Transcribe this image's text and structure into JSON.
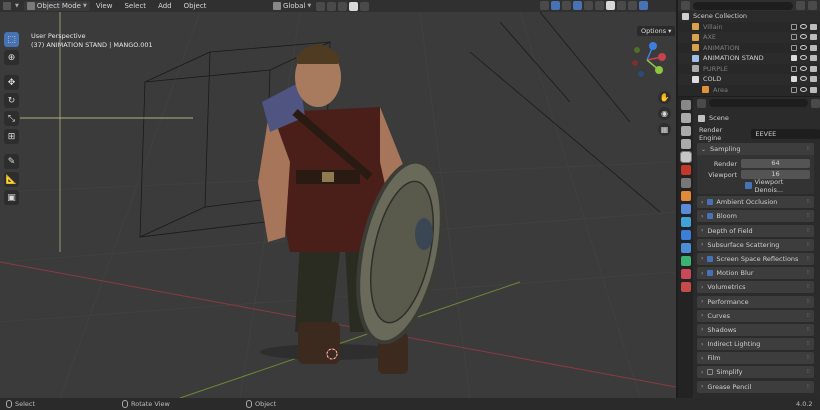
{
  "header": {
    "mode": "Object Mode",
    "menus": [
      "View",
      "Select",
      "Add",
      "Object"
    ],
    "transform_orientation": "Global",
    "options_label": "Options"
  },
  "viewport": {
    "perspective": "User Perspective",
    "object_info": "(37) ANIMATION STAND | MANGO.001"
  },
  "outliner": {
    "root": "Scene Collection",
    "items": [
      {
        "label": "Villain",
        "dim": true,
        "color": "#d9a24a"
      },
      {
        "label": "AXE",
        "dim": true,
        "color": "#d9a24a"
      },
      {
        "label": "ANIMATION",
        "dim": true,
        "color": "#d9a24a"
      },
      {
        "label": "ANIMATION STAND",
        "dim": false,
        "color": "#9ec0e8"
      },
      {
        "label": "PURPLE",
        "dim": true,
        "color": "#aaaaaa"
      },
      {
        "label": "COLD",
        "dim": false,
        "color": "#dddddd"
      },
      {
        "label": "Area",
        "dim": true,
        "color": "#e0913a"
      }
    ]
  },
  "properties": {
    "context": "Scene",
    "render_engine_label": "Render Engine",
    "render_engine": "EEVEE",
    "sampling": {
      "title": "Sampling",
      "render_label": "Render",
      "render_value": "64",
      "viewport_label": "Viewport",
      "viewport_value": "16",
      "denoise_label": "Viewport Denois..."
    },
    "panels": [
      {
        "label": "Ambient Occlusion",
        "check": true
      },
      {
        "label": "Bloom",
        "check": true
      },
      {
        "label": "Depth of Field",
        "check": null
      },
      {
        "label": "Subsurface Scattering",
        "check": null
      },
      {
        "label": "Screen Space Reflections",
        "check": true
      },
      {
        "label": "Motion Blur",
        "check": true
      },
      {
        "label": "Volumetrics",
        "check": null
      },
      {
        "label": "Performance",
        "check": null
      },
      {
        "label": "Curves",
        "check": null
      },
      {
        "label": "Shadows",
        "check": null
      },
      {
        "label": "Indirect Lighting",
        "check": null
      },
      {
        "label": "Film",
        "check": null
      },
      {
        "label": "Simplify",
        "check": false
      },
      {
        "label": "Grease Pencil",
        "check": null
      }
    ]
  },
  "status": {
    "select": "Select",
    "rotate": "Rotate View",
    "object": "Object",
    "version": "4.0.2"
  },
  "colors": {
    "accent": "#4772b3",
    "x_axis": "#c8414b",
    "y_axis": "#8dc63f",
    "z_axis": "#3d7fdf"
  }
}
